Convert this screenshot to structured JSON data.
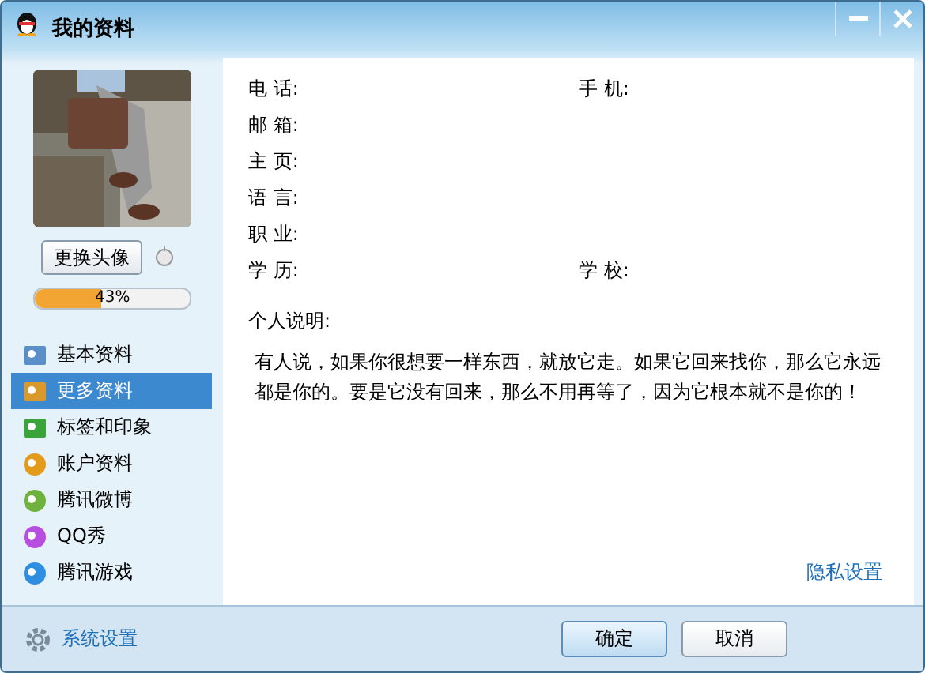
{
  "window": {
    "title": "我的资料",
    "controls": [
      {
        "kind": "minimize"
      },
      {
        "kind": "close"
      }
    ]
  },
  "profile": {
    "change_avatar_button": "更换头像",
    "completion": {
      "level": 0.43,
      "reading": "43%"
    }
  },
  "sidebar": {
    "items": [
      {
        "label": "基本资料",
        "selected": false
      },
      {
        "label": "更多资料",
        "selected": true
      },
      {
        "label": "标签和印象",
        "selected": false
      },
      {
        "label": "账户资料",
        "selected": false
      },
      {
        "label": "腾讯微博",
        "selected": false
      },
      {
        "label": "QQ秀",
        "selected": false
      },
      {
        "label": "腾讯游戏",
        "selected": false
      }
    ]
  },
  "fields": [
    [
      {
        "label": "电 话:"
      },
      {
        "label": "手 机:"
      }
    ],
    [
      {
        "label": "邮 箱:"
      }
    ],
    [
      {
        "label": "主 页:"
      }
    ],
    [
      {
        "label": "语 言:"
      }
    ],
    [
      {
        "label": "职 业:"
      }
    ],
    [
      {
        "label": "学 历:"
      },
      {
        "label": "学 校:"
      }
    ]
  ],
  "personal_note": {
    "label": "个人说明:",
    "text": "有人说，如果你很想要一样东西，就放它走。如果它回来找你，那么它永远都是你的。要是它没有回来，那么不用再等了，因为它根本就不是你的！"
  },
  "privacy_link": "隐私设置",
  "footer": {
    "settings_link": "系统设置",
    "buttons": [
      "确定",
      "取消"
    ]
  }
}
